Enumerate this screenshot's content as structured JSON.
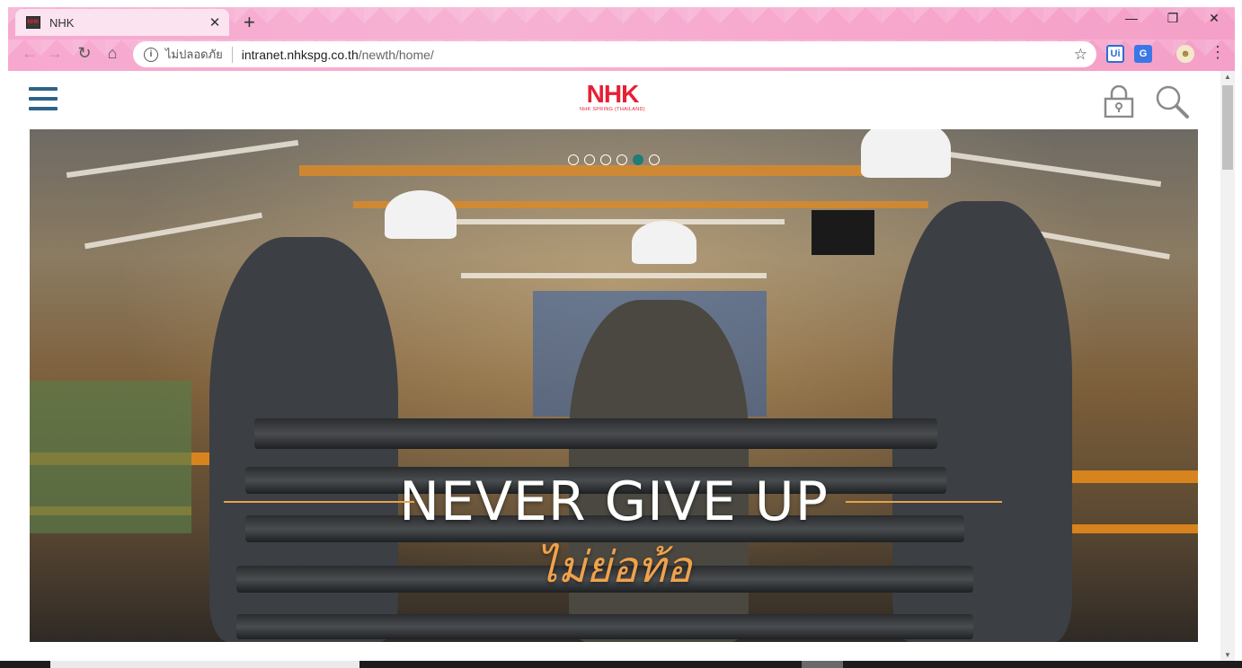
{
  "browser": {
    "tab_title": "NHK",
    "favicon_text": "NHK",
    "new_tab": "+",
    "close_tab": "✕",
    "minimize": "—",
    "restore": "❐",
    "close_window": "✕",
    "address": {
      "security_label": "ไม่ปลอดภัย",
      "host": "intranet.nhkspg.co.th",
      "path": "/newth/home/"
    },
    "extensions": {
      "uipath": "Ui",
      "translate": "G"
    }
  },
  "site": {
    "logo_text": "NHK",
    "logo_subtitle": "NHK SPRING (THAILAND)",
    "slider": {
      "count": 6,
      "active_index": 4
    },
    "slogan_en": "NEVER  GIVE  UP",
    "slogan_th": "ไม่ย่อท้อ"
  },
  "colors": {
    "chrome_pink": "#f7a8cf",
    "brand_red": "#e62035",
    "hamburger_blue": "#2d6388",
    "slogan_orange": "#f0a24b",
    "active_dot": "#1f7c77"
  }
}
